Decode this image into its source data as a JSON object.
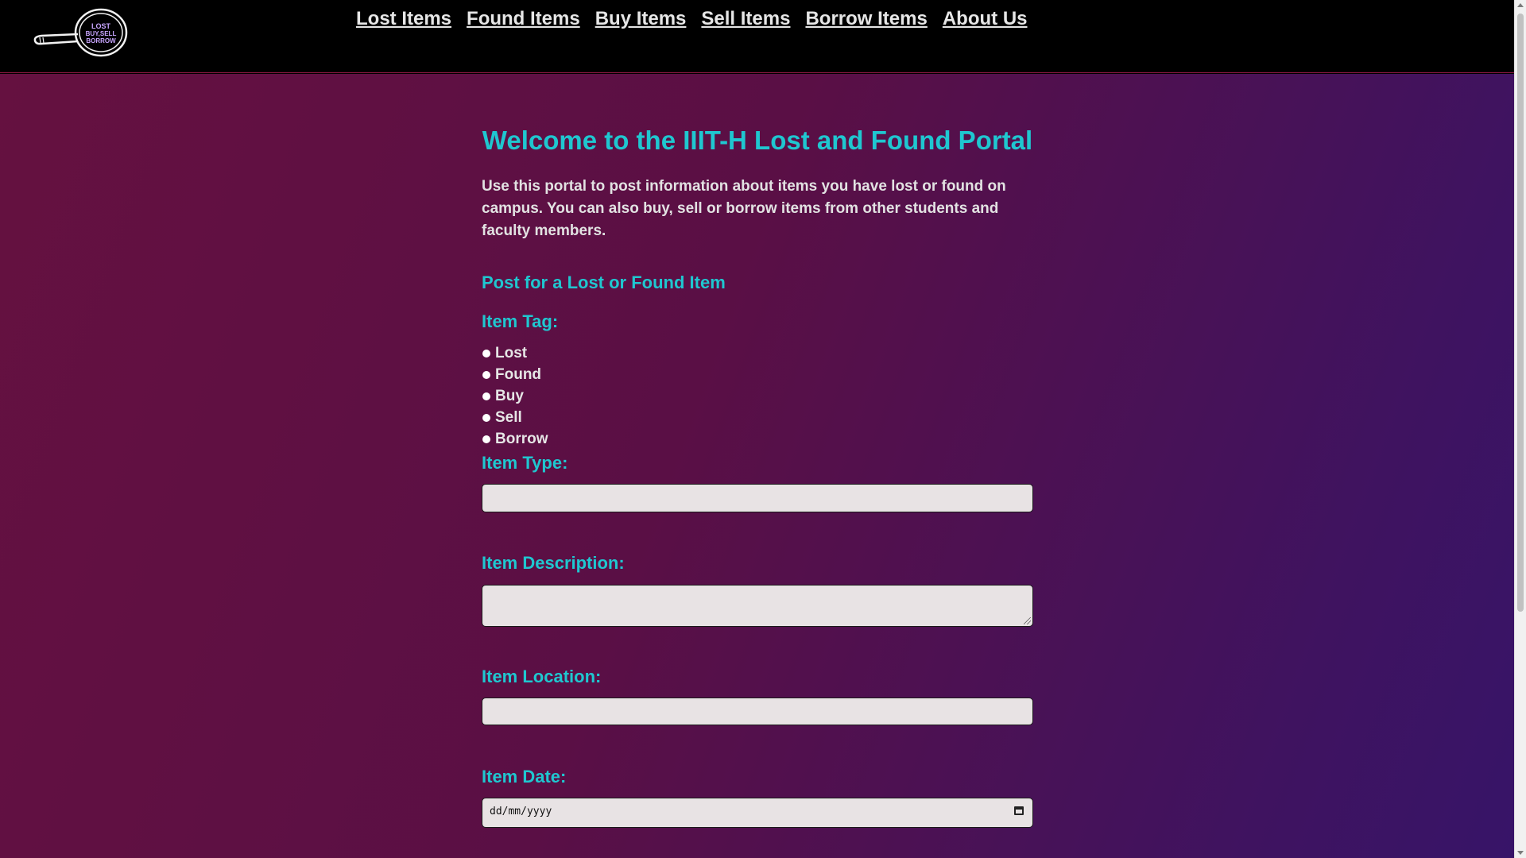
{
  "logo": {
    "line1": "LOST",
    "line2": "BUY,SELL",
    "line3": "BORROW"
  },
  "nav": {
    "items": [
      {
        "label": "Lost Items"
      },
      {
        "label": "Found Items"
      },
      {
        "label": "Buy Items"
      },
      {
        "label": "Sell Items"
      },
      {
        "label": "Borrow Items"
      },
      {
        "label": "About Us"
      }
    ]
  },
  "main": {
    "title": "Welcome to the IIIT-H Lost and Found Portal",
    "intro": "Use this portal to post information about items you have lost or found on campus. You can also buy, sell or borrow items from other students and faculty members.",
    "form_heading": "Post for a Lost or Found Item"
  },
  "form": {
    "tag_label": "Item Tag:",
    "tag_options": [
      "Lost",
      "Found",
      "Buy",
      "Sell",
      "Borrow"
    ],
    "type_label": "Item Type:",
    "type_value": "",
    "description_label": "Item Description:",
    "description_value": "",
    "location_label": "Item Location:",
    "location_value": "",
    "date_label": "Item Date:",
    "date_placeholder": "dd/mm/yyyy"
  },
  "colors": {
    "accent": "#1fc7d0",
    "nav_bg": "#000000",
    "bg_start": "#651140",
    "bg_end": "#371468"
  },
  "icons": [
    "magnifier-logo-icon",
    "calendar-icon",
    "resize-grip-icon"
  ]
}
